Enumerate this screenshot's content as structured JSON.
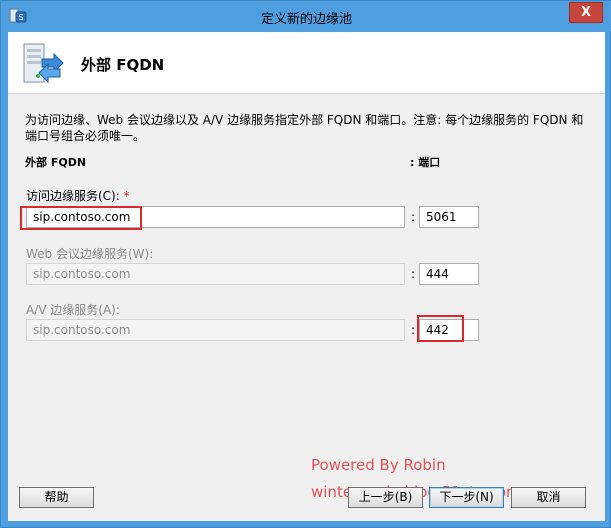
{
  "window": {
    "title": "定义新的边缘池",
    "close_label": "X"
  },
  "header": {
    "title": "外部 FQDN"
  },
  "description": "为访问边缘、Web 会议边缘以及 A/V 边缘服务指定外部 FQDN 和端口。注意: 每个边缘服务的 FQDN 和端口号组合必须唯一。",
  "columns": {
    "fqdn": "外部 FQDN",
    "port": ": 端口"
  },
  "fields": {
    "access": {
      "label": "访问边缘服务(C):",
      "required_mark": "*",
      "value": "sip.contoso.com",
      "colon": ":",
      "port": "5061"
    },
    "webconf": {
      "label": "Web 会议边缘服务(W):",
      "value": "sip.contoso.com",
      "colon": ":",
      "port": "444"
    },
    "av": {
      "label": "A/V 边缘服务(A):",
      "value": "sip.contoso.com",
      "colon": ":",
      "port": "442"
    }
  },
  "buttons": {
    "help": "帮助",
    "back": "上一步(B)",
    "next": "下一步(N)",
    "cancel": "取消"
  },
  "watermark": {
    "line1": "Powered By Robin",
    "line2": "winteragain.blog.51cto.com"
  },
  "colors": {
    "titlebar": "#4f9ee0",
    "close_button": "#c7463c",
    "highlight": "#d92b2b",
    "watermark": "#e0363b"
  }
}
